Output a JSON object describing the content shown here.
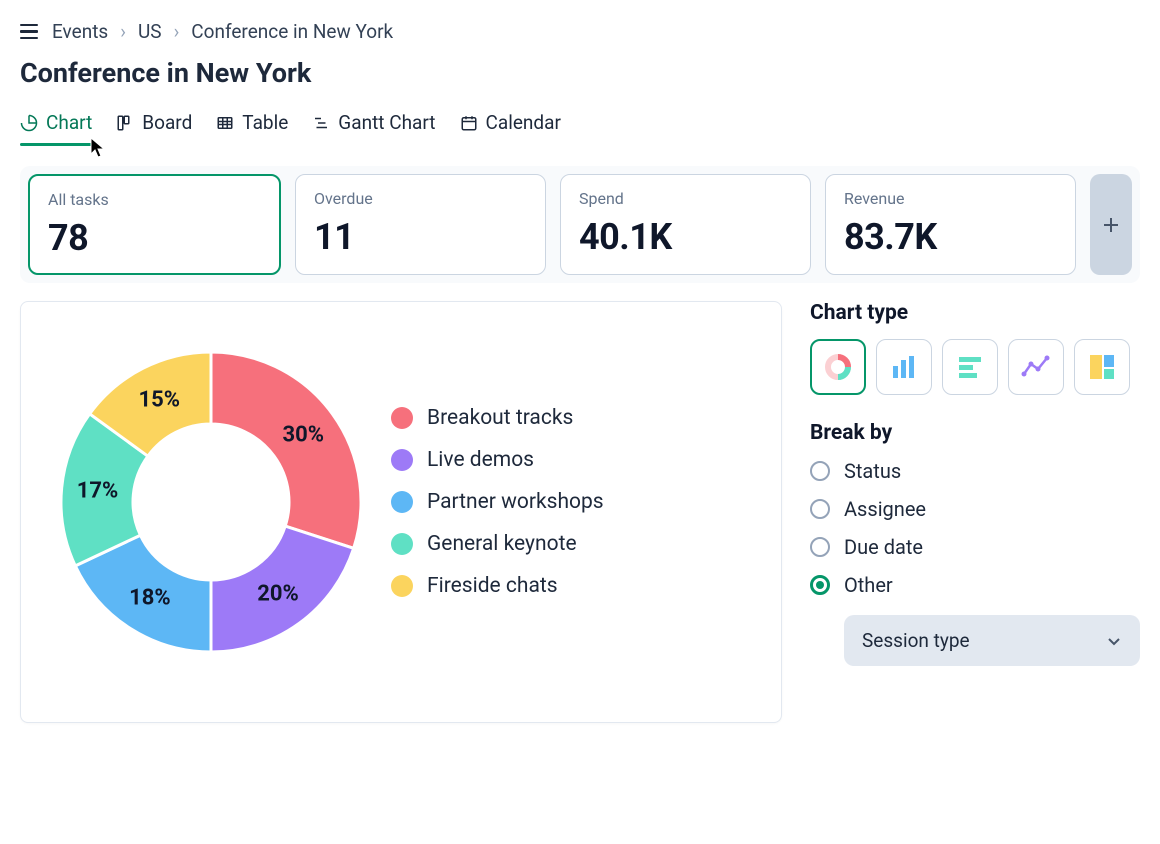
{
  "breadcrumb": {
    "root": "Events",
    "mid": "US",
    "current": "Conference in New York"
  },
  "page_title": "Conference in New York",
  "tabs": [
    {
      "label": "Chart"
    },
    {
      "label": "Board"
    },
    {
      "label": "Table"
    },
    {
      "label": "Gantt Chart"
    },
    {
      "label": "Calendar"
    }
  ],
  "summary": [
    {
      "label": "All tasks",
      "value": "78"
    },
    {
      "label": "Overdue",
      "value": "11"
    },
    {
      "label": "Spend",
      "value": "40.1K"
    },
    {
      "label": "Revenue",
      "value": "83.7K"
    }
  ],
  "chart_legend": [
    {
      "label": "Breakout tracks",
      "color": "#F6707C",
      "pct": "30%"
    },
    {
      "label": "Live demos",
      "color": "#9D7AF7",
      "pct": "20%"
    },
    {
      "label": "Partner workshops",
      "color": "#5DB7F5",
      "pct": "18%"
    },
    {
      "label": "General keynote",
      "color": "#5FE0C4",
      "pct": "17%"
    },
    {
      "label": "Fireside chats",
      "color": "#FBD45E",
      "pct": "15%"
    }
  ],
  "side": {
    "chart_type_title": "Chart type",
    "break_by_title": "Break by",
    "break_by_options": [
      "Status",
      "Assignee",
      "Due date",
      "Other"
    ],
    "break_by_selected": "Other",
    "dropdown_value": "Session type"
  },
  "chart_data": {
    "type": "pie",
    "title": "",
    "categories": [
      "Breakout tracks",
      "Live demos",
      "Partner workshops",
      "General keynote",
      "Fireside chats"
    ],
    "values": [
      30,
      20,
      18,
      17,
      15
    ],
    "colors": [
      "#F6707C",
      "#9D7AF7",
      "#5DB7F5",
      "#5FE0C4",
      "#FBD45E"
    ]
  }
}
